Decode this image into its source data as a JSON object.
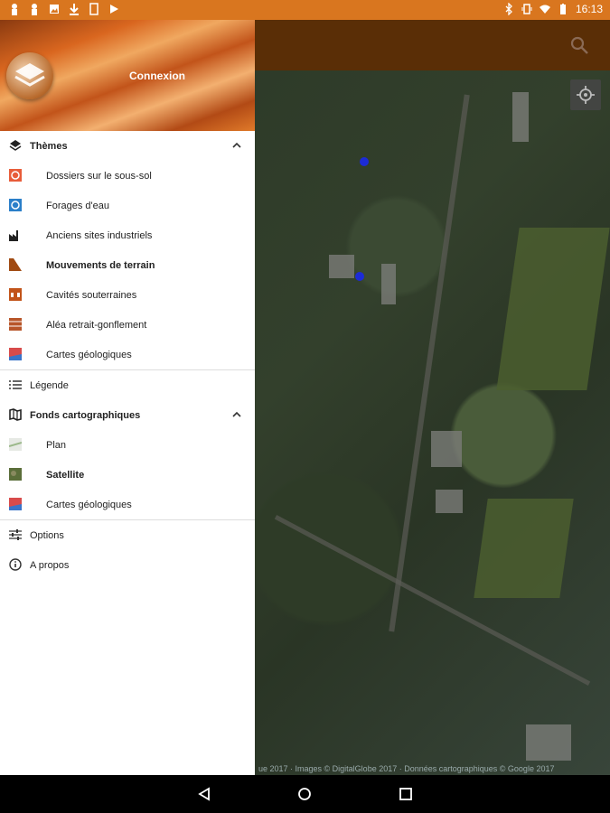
{
  "status_bar": {
    "time": "16:13"
  },
  "header": {
    "connexion_label": "Connexion"
  },
  "themes": {
    "title": "Thèmes",
    "items": [
      {
        "label": "Dossiers sur le sous-sol",
        "bold": false
      },
      {
        "label": "Forages d'eau",
        "bold": false
      },
      {
        "label": "Anciens sites industriels",
        "bold": false
      },
      {
        "label": "Mouvements de terrain",
        "bold": true
      },
      {
        "label": "Cavités souterraines",
        "bold": false
      },
      {
        "label": "Aléa retrait-gonflement",
        "bold": false
      },
      {
        "label": "Cartes géologiques",
        "bold": false
      }
    ]
  },
  "legend": {
    "label": "Légende"
  },
  "fonds": {
    "title": "Fonds cartographiques",
    "items": [
      {
        "label": "Plan",
        "bold": false
      },
      {
        "label": "Satellite",
        "bold": true
      },
      {
        "label": "Cartes géologiques",
        "bold": false
      }
    ]
  },
  "options": {
    "label": "Options"
  },
  "about": {
    "label": "A propos"
  },
  "map": {
    "attribution": "ue 2017 · Images © DigitalGlobe 2017 · Données cartographiques © Google 2017"
  },
  "colors": {
    "accent": "#d9761f",
    "map_bar": "#5a2e06",
    "marker": "#1c2bd6"
  }
}
